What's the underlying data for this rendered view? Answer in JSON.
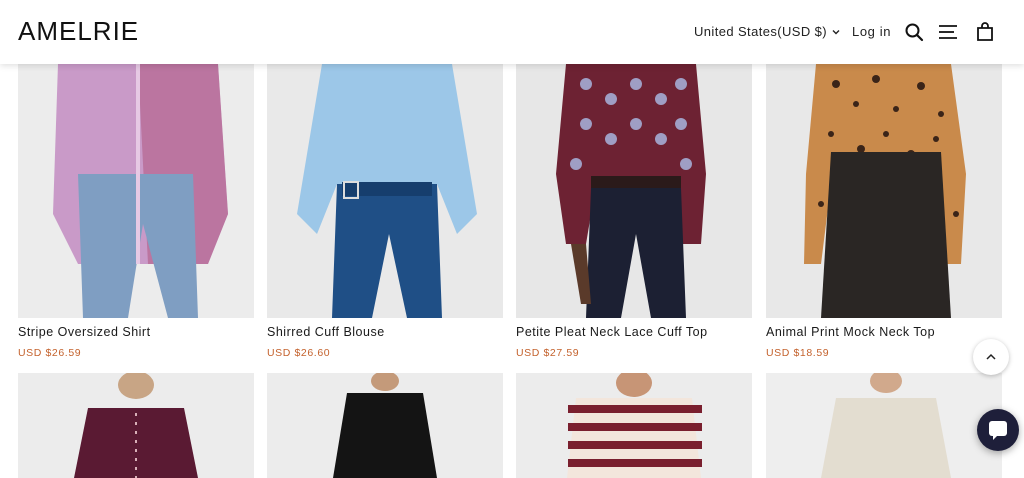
{
  "header": {
    "logo": "AMELRIE",
    "country_selector": "United States(USD $)",
    "login": "Log in",
    "icons": [
      "search-icon",
      "menu-icon",
      "cart-icon"
    ]
  },
  "products_row1": [
    {
      "title": "Stripe Oversized Shirt",
      "price": "USD $26.59"
    },
    {
      "title": "Shirred Cuff Blouse",
      "price": "USD $26.60"
    },
    {
      "title": "Petite Pleat Neck Lace Cuff Top",
      "price": "USD $27.59"
    },
    {
      "title": "Animal Print Mock Neck Top",
      "price": "USD $18.59"
    }
  ],
  "colors": {
    "price": "#c4622d",
    "chat_button": "#1e1f3a"
  },
  "floating": {
    "scroll_top_icon": "chevron-up-icon",
    "chat_icon": "chat-icon"
  }
}
